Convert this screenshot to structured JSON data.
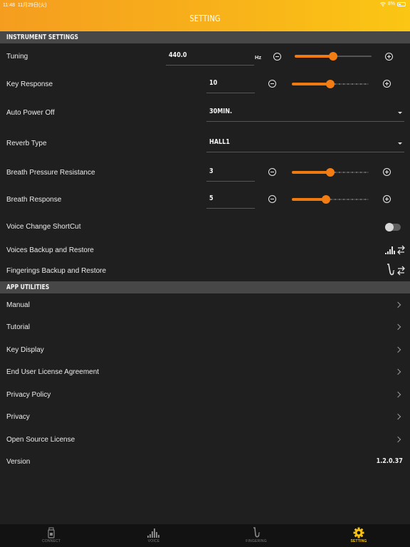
{
  "status_bar": {
    "time": "11:48",
    "date": "11月29日(火)",
    "battery": "8%"
  },
  "header": {
    "title": "SETTING"
  },
  "instrument_settings": {
    "section_title": "INSTRUMENT SETTINGS",
    "tuning": {
      "label": "Tuning",
      "value": "440.0",
      "unit": "Hz",
      "slider_fraction": 0.5
    },
    "key_response": {
      "label": "Key Response",
      "value": "10",
      "slider_fraction": 0.5
    },
    "auto_power_off": {
      "label": "Auto Power Off",
      "value": "30MIN."
    },
    "reverb_type": {
      "label": "Reverb Type",
      "value": "HALL1"
    },
    "breath_pressure_resistance": {
      "label": "Breath Pressure Resistance",
      "value": "3",
      "slider_fraction": 0.5
    },
    "breath_response": {
      "label": "Breath Response",
      "value": "5",
      "slider_fraction": 0.44
    },
    "voice_change_shortcut": {
      "label": "Voice Change ShortCut",
      "enabled": false
    },
    "voices_backup": {
      "label": "Voices Backup and Restore",
      "icon": "voices-backup-icon"
    },
    "fingerings_backup": {
      "label": "Fingerings Backup and Restore",
      "icon": "saxophone-backup-icon"
    }
  },
  "app_utilities": {
    "section_title": "APP UTILITIES",
    "items": [
      {
        "label": "Manual"
      },
      {
        "label": "Tutorial"
      },
      {
        "label": "Key Display"
      },
      {
        "label": "End User License Agreement"
      },
      {
        "label": "Privacy Policy"
      },
      {
        "label": "Privacy"
      },
      {
        "label": "Open Source License"
      }
    ],
    "version": {
      "label": "Version",
      "value": "1.2.0.37"
    }
  },
  "tabbar": {
    "tabs": [
      {
        "label": "CONNECT",
        "icon": "connect-icon",
        "active": false
      },
      {
        "label": "VOICE",
        "icon": "voice-icon",
        "active": false
      },
      {
        "label": "FINGERING",
        "icon": "fingering-icon",
        "active": false
      },
      {
        "label": "SETTING",
        "icon": "gear-icon",
        "active": true
      }
    ]
  },
  "colors": {
    "accent": "#f37d12",
    "header_start": "#f59d1f",
    "header_end": "#fbc614",
    "active_tab": "#f5c214",
    "background": "#1f1f1f"
  }
}
